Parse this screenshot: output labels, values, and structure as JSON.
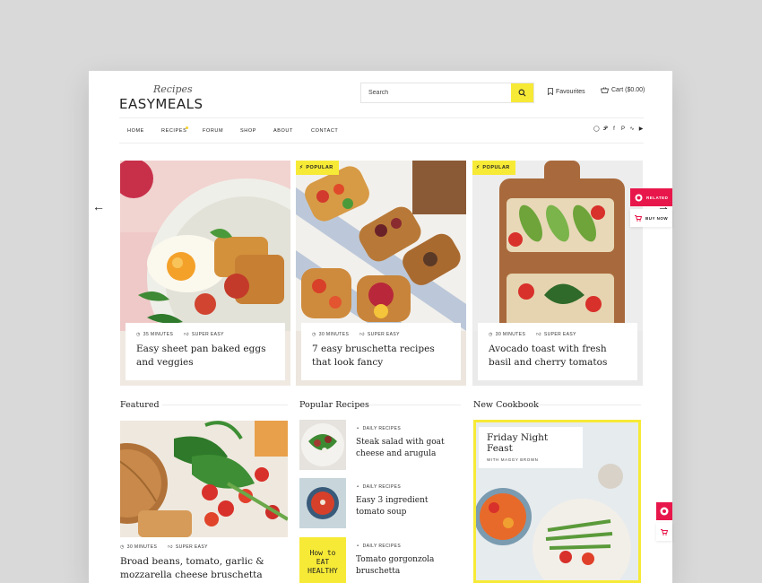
{
  "logo": {
    "script": "Recipes",
    "main": "EASYMEALS"
  },
  "header": {
    "search_placeholder": "Search",
    "favourites_label": "Favourites",
    "cart_label": "Cart ($0.00)"
  },
  "nav": {
    "items": [
      "HOME",
      "RECIPES",
      "FORUM",
      "SHOP",
      "ABOUT",
      "CONTACT"
    ],
    "social_icons": [
      "instagram-icon",
      "twitter-icon",
      "facebook-icon",
      "pinterest-icon",
      "rss-icon",
      "youtube-icon"
    ]
  },
  "slider": {
    "slides": [
      {
        "badge": "",
        "time": "35 MINUTES",
        "difficulty": "SUPER EASY",
        "title": "Easy sheet pan baked eggs and veggies"
      },
      {
        "badge": "POPULAR",
        "time": "30 MINUTES",
        "difficulty": "SUPER EASY",
        "title": "7 easy bruschetta recipes that look fancy"
      },
      {
        "badge": "POPULAR",
        "time": "30 MINUTES",
        "difficulty": "SUPER EASY",
        "title": "Avocado toast with fresh basil and cherry tomatos"
      }
    ]
  },
  "side_widget": {
    "related": "RELATED",
    "buy_now": "BUY NOW"
  },
  "featured": {
    "heading": "Featured",
    "time": "30 MINUTES",
    "difficulty": "SUPER EASY",
    "title": "Broad beans, tomato, garlic & mozzarella cheese bruschetta"
  },
  "popular": {
    "heading": "Popular Recipes",
    "items": [
      {
        "category": "DAILY RECIPES",
        "title": "Steak salad with goat cheese and arugula"
      },
      {
        "category": "DAILY RECIPES",
        "title": "Easy 3 ingredient tomato soup"
      },
      {
        "category": "DAILY RECIPES",
        "title": "Tomato gorgonzola bruschetta"
      }
    ],
    "thumb_book_text": "How to EAT HEALTHY"
  },
  "cookbook": {
    "heading": "New Cookbook",
    "title": "Friday Night Feast",
    "subtitle": "WITH MAGGY BROWN"
  },
  "colors": {
    "accent": "#f7ea36",
    "red": "#e8174b",
    "text": "#222222"
  }
}
